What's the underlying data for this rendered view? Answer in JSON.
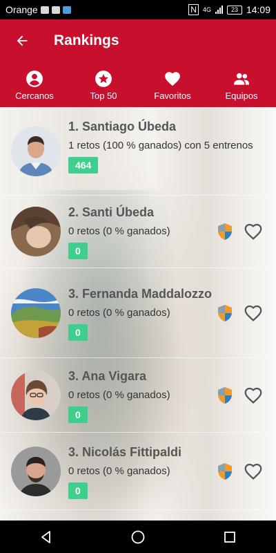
{
  "status_bar": {
    "carrier": "Orange",
    "network": "4G",
    "battery": "23",
    "time": "14:09"
  },
  "app_bar": {
    "title": "Rankings"
  },
  "tabs": [
    {
      "label": "Cercanos",
      "icon": "account-circle-icon"
    },
    {
      "label": "Top 50",
      "icon": "star-circle-icon"
    },
    {
      "label": "Favoritos",
      "icon": "heart-icon"
    },
    {
      "label": "Equipos",
      "icon": "group-icon"
    }
  ],
  "rankings": [
    {
      "name": "1. Santiago Úbeda",
      "stats": "1 retos (100 % ganados) con 5 entrenos",
      "score": "464"
    },
    {
      "name": "2. Santi Úbeda",
      "stats": "0 retos (0 % ganados)",
      "score": "0"
    },
    {
      "name": "3. Fernanda Maddalozzo",
      "stats": "0 retos (0 % ganados)",
      "score": "0"
    },
    {
      "name": "3. Ana Vigara",
      "stats": "0 retos (0 % ganados)",
      "score": "0"
    },
    {
      "name": "3. Nicolás Fittipaldi",
      "stats": "0 retos (0 % ganados)",
      "score": "0"
    }
  ],
  "colors": {
    "primary": "#c8102e",
    "score_badge": "#3ecf8e"
  }
}
